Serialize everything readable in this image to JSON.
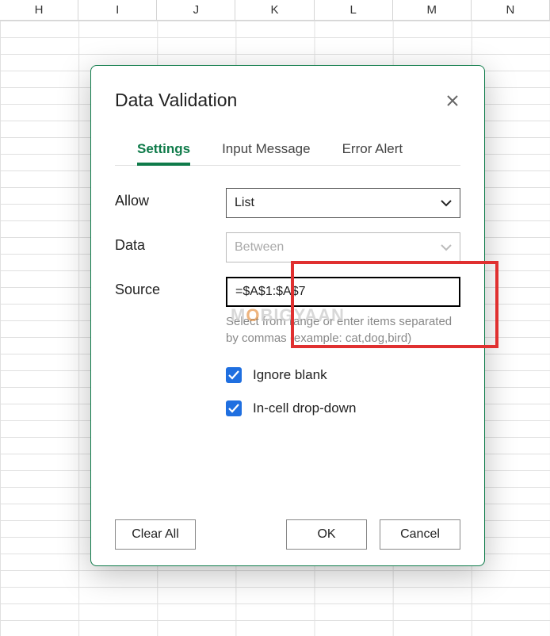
{
  "columns": [
    "H",
    "I",
    "J",
    "K",
    "L",
    "M",
    "N"
  ],
  "dialog": {
    "title": "Data Validation",
    "tabs": {
      "settings": "Settings",
      "input_message": "Input Message",
      "error_alert": "Error Alert"
    },
    "labels": {
      "allow": "Allow",
      "data": "Data",
      "source": "Source"
    },
    "fields": {
      "allow_value": "List",
      "data_value": "Between",
      "source_value": "=$A$1:$A$7",
      "source_hint": "Select from range or enter items separated by commas (example: cat,dog,bird)"
    },
    "checks": {
      "ignore_blank": "Ignore blank",
      "incell_dropdown": "In-cell drop-down"
    },
    "buttons": {
      "clear_all": "Clear All",
      "ok": "OK",
      "cancel": "Cancel"
    }
  },
  "watermark": {
    "pre": "M",
    "accent": "O",
    "post": "BIGYAAN"
  }
}
